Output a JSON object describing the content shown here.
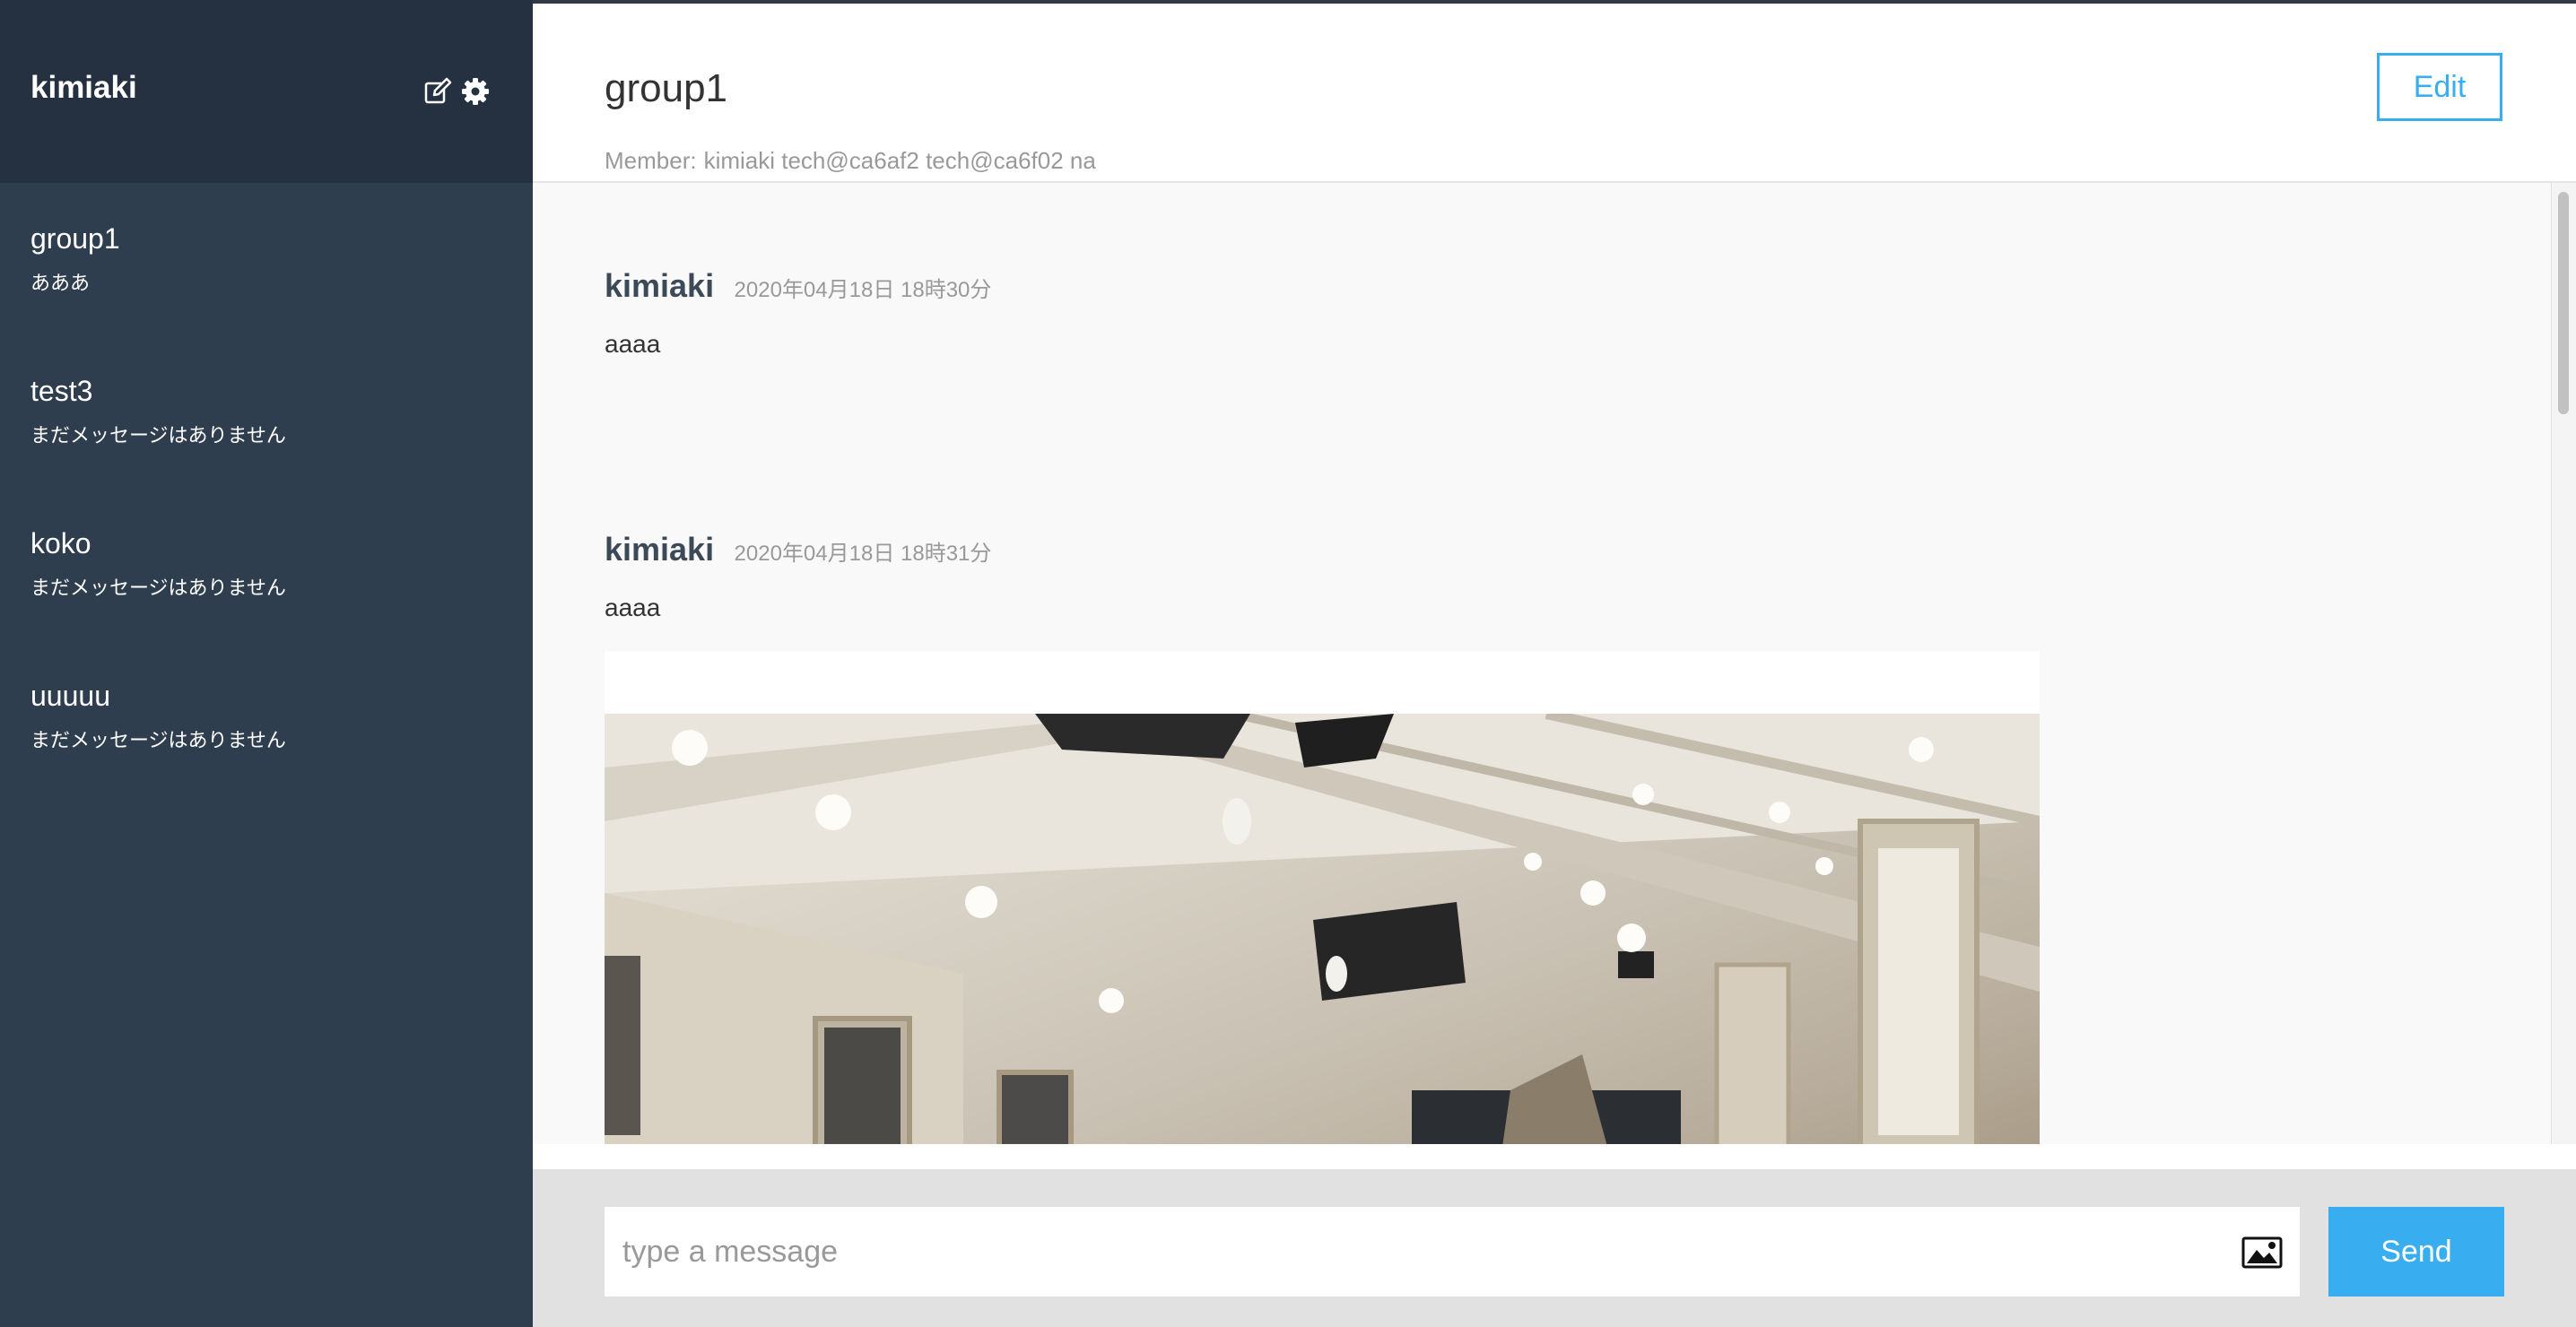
{
  "sidebar": {
    "user_name": "kimiaki",
    "header_icons": [
      "edit-icon",
      "gear-icon"
    ],
    "groups": [
      {
        "name": "group1",
        "last_message": "あああ"
      },
      {
        "name": "test3",
        "last_message": "まだメッセージはありません"
      },
      {
        "name": "koko",
        "last_message": "まだメッセージはありません"
      },
      {
        "name": "uuuuu",
        "last_message": "まだメッセージはありません"
      }
    ]
  },
  "header": {
    "title": "group1",
    "members_label": "Member:",
    "members": "kimiaki tech@ca6af2 tech@ca6f02 na",
    "edit_label": "Edit"
  },
  "messages": [
    {
      "user": "kimiaki",
      "time": "2020年04月18日 18時30分",
      "text": "aaaa"
    },
    {
      "user": "kimiaki",
      "time": "2020年04月18日 18時31分",
      "text": "aaaa"
    }
  ],
  "compose": {
    "placeholder": "type a message",
    "image_icon": "image-icon",
    "send_label": "Send"
  },
  "colors": {
    "sidebar_bg": "#2f3e4e",
    "sidebar_header_bg": "#253141",
    "accent": "#38aef0",
    "compose_bg": "#e1e1e1"
  }
}
